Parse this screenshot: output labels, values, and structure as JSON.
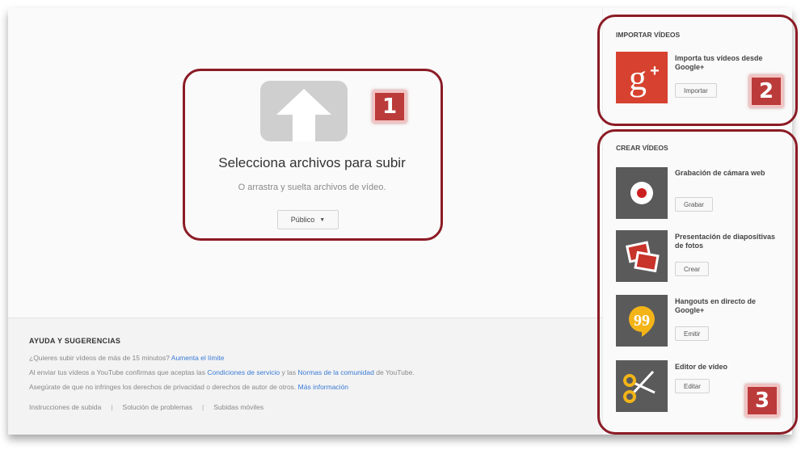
{
  "upload": {
    "title": "Selecciona archivos para subir",
    "subtitle": "O arrastra y suelta archivos de vídeo.",
    "privacy_label": "Público",
    "privacy_caret": "▼"
  },
  "help": {
    "title": "AYUDA Y SUGERENCIAS",
    "line1_text": "¿Quieres subir vídeos de más de 15 minutos?",
    "line1_link": "Aumenta el límite",
    "line2_text_a": "Al enviar tus vídeos a YouTube confirmas que aceptas las",
    "line2_link_a": "Condiciones de servicio",
    "line2_text_b": "y las",
    "line2_link_b": "Normas de la comunidad",
    "line2_text_c": "de YouTube.",
    "line3_text": "Asegúrate de que no infringes los derechos de privacidad o derechos de autor de otros.",
    "line3_link": "Más información",
    "links": [
      "Instrucciones de subida",
      "Solución de problemas",
      "Subidas móviles"
    ],
    "separator": "|"
  },
  "sidebar": {
    "import_title": "IMPORTAR VÍDEOS",
    "import_item": {
      "text": "Importa tus vídeos desde Google+",
      "button": "Importar",
      "icon": "google-plus-icon",
      "icon_text": "g+"
    },
    "create_title": "CREAR VÍDEOS",
    "create_items": [
      {
        "text": "Grabación de cámara web",
        "button": "Grabar",
        "icon": "webcam-record-icon"
      },
      {
        "text": "Presentación de diapositivas de fotos",
        "button": "Crear",
        "icon": "photo-slideshow-icon"
      },
      {
        "text": "Hangouts en directo de Google+",
        "button": "Emitir",
        "icon": "hangouts-icon"
      },
      {
        "text": "Editor de vídeo",
        "button": "Editar",
        "icon": "video-editor-icon"
      }
    ]
  },
  "callouts": [
    "1",
    "2",
    "3"
  ],
  "colors": {
    "callout_border": "#8b1b25",
    "badge_bg": "#bb3b3b",
    "link": "#3a7bd5",
    "google_plus": "#d6422f",
    "hangouts": "#f3b418"
  }
}
